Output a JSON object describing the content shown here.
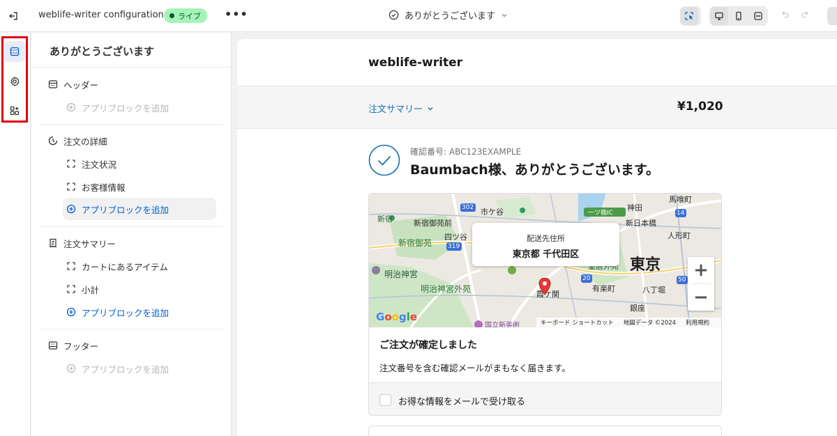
{
  "topbar": {
    "app_title": "weblife-writer configuration",
    "live_badge": "ライブ",
    "more": "•••",
    "page_selector": "ありがとうございます"
  },
  "rail": {
    "items": [
      {
        "name": "sections",
        "icon": "layout-sections-icon",
        "active": true
      },
      {
        "name": "settings",
        "icon": "gear-icon",
        "active": false
      },
      {
        "name": "apps",
        "icon": "apps-add-icon",
        "active": false
      }
    ],
    "highlight_color": "#e0000f"
  },
  "sidebar": {
    "title": "ありがとうございます",
    "groups": [
      {
        "label": "ヘッダー",
        "icon": "header-icon",
        "add_block": "アプリブロックを追加"
      },
      {
        "label": "注文の詳細",
        "icon": "order-details-icon",
        "children": [
          "注文状況",
          "お客様情報"
        ],
        "add_block": "アプリブロックを追加"
      },
      {
        "label": "注文サマリー",
        "icon": "receipt-icon",
        "children": [
          "カートにあるアイテム",
          "小計"
        ],
        "add_block": "アプリブロックを追加"
      },
      {
        "label": "フッター",
        "icon": "footer-icon",
        "add_block": "アプリブロックを追加"
      }
    ]
  },
  "preview": {
    "shop_name": "weblife-writer",
    "summary_toggle": "注文サマリー",
    "summary_total": "¥1,020",
    "confirmation_number": "確認番号: ABC123EXAMPLE",
    "thanks_heading": "Baumbach様、ありがとうございます。",
    "map": {
      "popup_label": "配送先住所",
      "popup_value": "東京都 千代田区",
      "footer_links": [
        "キーボード ショートカット",
        "地図データ ©2024",
        "利用規約"
      ],
      "google": "Google",
      "place_labels": [
        "市ケ谷",
        "新宿",
        "新宿御苑前",
        "新宿御苑",
        "四ツ谷",
        "明治神宮",
        "明治神宮外苑",
        "東京",
        "神田",
        "新日本橋",
        "馬喰町",
        "人形町",
        "皇居外苑",
        "有楽町",
        "八丁堀",
        "霞ケ関",
        "銀座",
        "一ツ橋IC",
        "国立新美術"
      ],
      "route_numbers": [
        "302",
        "319",
        "20",
        "14",
        "50"
      ]
    },
    "card_title": "ご注文が確定しました",
    "card_text": "注文番号を含む確認メールがまもなく届きます。",
    "newsletter_label": "お得な情報をメールで受け取る"
  },
  "colors": {
    "accent_link": "#005bd3",
    "live_badge_bg": "#a6f3b8",
    "live_badge_text": "#0c5132",
    "summary_link": "#1773b0"
  }
}
